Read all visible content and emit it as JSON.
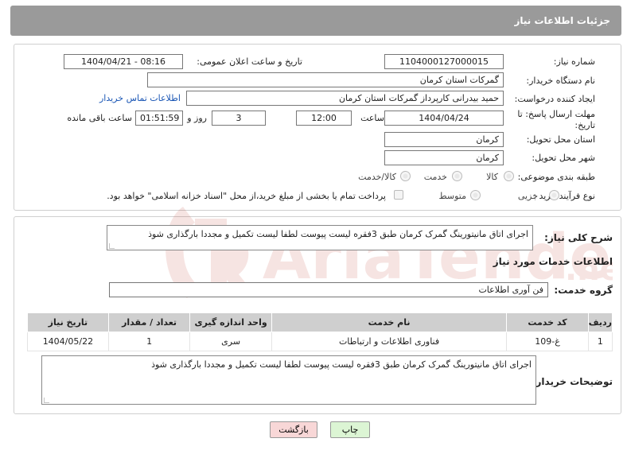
{
  "header": {
    "title": "جزئیات اطلاعات نیاز"
  },
  "fields": {
    "need_number_label": "شماره نیاز:",
    "need_number": "1104000127000015",
    "announce_label": "تاریخ و ساعت اعلان عمومی:",
    "announce_value": "1404/04/21 - 08:16",
    "buyer_org_label": "نام دستگاه خریدار:",
    "buyer_org": "گمرکات استان کرمان",
    "creator_label": "ایجاد کننده درخواست:",
    "creator": "حمید بیدرانی کارپرداز گمرکات استان کرمان",
    "contact_link": "اطلاعات تماس خریدار",
    "deadline_label_1": "مهلت ارسال پاسخ: تا",
    "deadline_label_2": "تاریخ:",
    "deadline_date": "1404/04/24",
    "time_label": "ساعت",
    "deadline_time": "12:00",
    "days_value": "3",
    "days_label": "روز و",
    "remaining_value": "01:51:59",
    "remaining_label": "ساعت باقی مانده",
    "province_label": "استان محل تحویل:",
    "province": "کرمان",
    "city_label": "شهر محل تحویل:",
    "city": "کرمان",
    "category_label": "طبقه بندی موضوعی:",
    "category_options": [
      "کالا",
      "خدمت",
      "کالا/خدمت"
    ],
    "process_label": "نوع فرآیند خرید :",
    "process_options": [
      "جزیی",
      "متوسط"
    ],
    "payment_note": "پرداخت تمام یا بخشی از مبلغ خرید،از محل \"اسناد خزانه اسلامی\" خواهد بود."
  },
  "summary": {
    "label": "شرح کلی نیاز:",
    "text": "اجرای اتاق مانیتورینگ گمرک کرمان طبق 3فقره لیست پیوست لطفا لیست تکمیل و مجددا بارگذاری شوذ"
  },
  "services": {
    "section_title": "اطلاعات خدمات مورد نیاز",
    "group_label": "گروه خدمت:",
    "group_value": "فن آوری اطلاعات",
    "columns": [
      "ردیف",
      "کد خدمت",
      "نام خدمت",
      "واحد اندازه گیری",
      "تعداد / مقدار",
      "تاریخ نیاز"
    ],
    "rows": [
      [
        "1",
        "غ-109",
        "فناوری اطلاعات و ارتباطات",
        "سری",
        "1",
        "1404/05/22"
      ]
    ]
  },
  "buyer_notes": {
    "label": "توضیحات خریدار:",
    "text": "اجرای اتاق مانیتورینگ گمرک کرمان طبق 3فقره لیست پیوست لطفا لیست تکمیل و مجددا بارگذاری شوذ"
  },
  "buttons": {
    "print": "چاپ",
    "back": "بازگشت"
  },
  "colors": {
    "header_bg": "#9a9a9a",
    "link": "#1a56b5",
    "back_btn_bg": "#f8d7d7",
    "print_btn_bg": "#dcf5d4"
  }
}
